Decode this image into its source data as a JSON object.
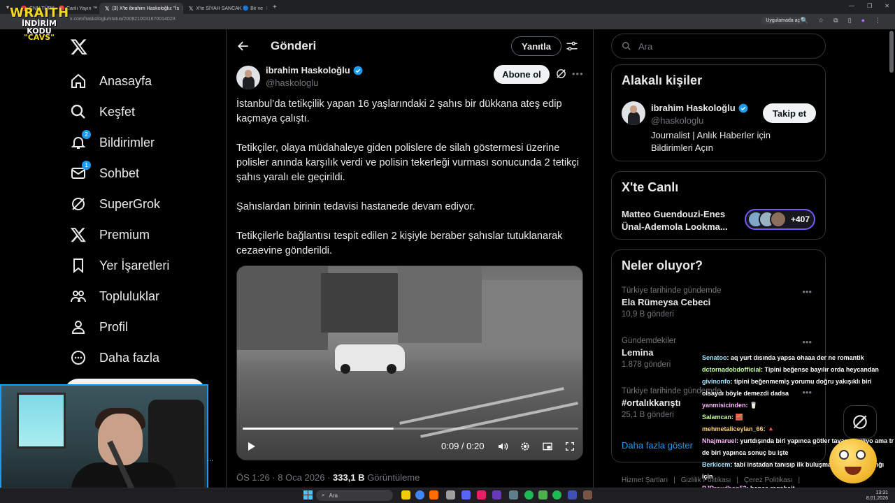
{
  "browser": {
    "tabs": [
      {
        "title": "CNN TÜRK - 🔴 Canlı Yayın ™",
        "color": "#ff0000",
        "active": false
      },
      {
        "title": "(3) X'te ibrahim Haskoloğlu: \"İs",
        "color": "#ffffff",
        "active": true
      },
      {
        "title": "X'te SİYAH SANCAK 🔵 Bir ve",
        "color": "#ffffff",
        "active": false
      }
    ],
    "url": "x.com/haskologlu/status/2009210031670014023",
    "app_chip": "Uygulamada aç"
  },
  "overlay": {
    "brand_top": "WRAITH",
    "brand_mid": "İNDİRİM KODU",
    "brand_bot": "\"CAVS\""
  },
  "nav": {
    "items": [
      {
        "label": "Anasayfa",
        "icon": "home-icon",
        "badge": ""
      },
      {
        "label": "Keşfet",
        "icon": "search-icon",
        "badge": ""
      },
      {
        "label": "Bildirimler",
        "icon": "bell-icon",
        "badge": "2"
      },
      {
        "label": "Sohbet",
        "icon": "mail-icon",
        "badge": "1"
      },
      {
        "label": "SuperGrok",
        "icon": "grok-icon",
        "badge": ""
      },
      {
        "label": "Premium",
        "icon": "x-icon",
        "badge": ""
      },
      {
        "label": "Yer İşaretleri",
        "icon": "bookmark-icon",
        "badge": ""
      },
      {
        "label": "Topluluklar",
        "icon": "communities-icon",
        "badge": ""
      },
      {
        "label": "Profil",
        "icon": "profile-icon",
        "badge": ""
      },
      {
        "label": "Daha fazla",
        "icon": "more-circle-icon",
        "badge": ""
      }
    ]
  },
  "post": {
    "header_title": "Gönderi",
    "reply_button": "Yanıtla",
    "author_name": "ibrahim Haskoloğlu",
    "author_handle": "@haskologlu",
    "subscribe_button": "Abone ol",
    "paragraphs": [
      "İstanbul’da tetikçilik yapan 16 yaşlarındaki 2 şahıs bir dükkana ateş edip kaçmaya çalıştı.",
      "Tetikçiler, olaya müdahaleye giden polislere de silah göstermesi üzerine polisler anında karşılık verdi ve polisin tekerleği vurması sonucunda 2 tetikçi şahıs yaralı ele geçirildi.",
      "Şahıslardan birinin tedavisi hastanede devam ediyor.",
      "Tetikçilerle bağlantısı tespit edilen 2 kişiyle beraber şahıslar tutuklanarak cezaevine gönderildi."
    ],
    "video": {
      "time": "0:09 / 0:20",
      "progress": 0.45
    },
    "meta_time": "ÖS 1:26 · 8 Oca 2026 · ",
    "meta_views": "333,1 B",
    "meta_views_label": " Görüntüleme"
  },
  "right": {
    "search_placeholder": "Ara",
    "related": {
      "title": "Alakalı kişiler",
      "name": "ibrahim Haskoloğlu",
      "handle": "@haskologlu",
      "bio": "Journalist | Anlık Haberler için Bildirimleri Açın",
      "follow_button": "Takip et"
    },
    "live": {
      "title": "X'te Canlı",
      "event": "Matteo Guendouzi-Enes Ünal-Ademola Lookma...",
      "count": "+407"
    },
    "trends": {
      "title": "Neler oluyor?",
      "items": [
        {
          "category": "Türkiye tarihinde gündemde",
          "name": "Ela Rümeysa Cebeci",
          "count": "10,9 B gönderi"
        },
        {
          "category": "Gündemdekiler",
          "name": "Lemina",
          "count": "1.878 gönderi"
        },
        {
          "category": "Türkiye tarihinde gündemde",
          "name": "#ortalıkkarıştı",
          "count": "25,1 B gönderi"
        }
      ],
      "show_more": "Daha fazla göster"
    },
    "footer": [
      "Hizmet Şartları",
      "|",
      "Gizlilik Politikası",
      "|",
      "Çerez Politikası",
      "|"
    ]
  },
  "chat": [
    {
      "user": "Senatoo",
      "msg": ": aq yurt dısında yapsa ohaaa der ne romantik",
      "cls": "u1"
    },
    {
      "user": "dctornadobdofficial",
      "msg": ": Tipini beğense bayılır orda heycandan",
      "cls": "u2"
    },
    {
      "user": "givinonfo",
      "msg": ": tipini beğenmemiş yorumu doğru yakışıklı biri olsaydı böyle demezdi dadsa",
      "cls": "u1"
    },
    {
      "user": "yanmisicinden",
      "msg": ": 🥛",
      "cls": "u3"
    },
    {
      "user": "Salamcan",
      "msg": ": 🧱",
      "cls": "u2"
    },
    {
      "user": "mehmetaliceylan_66",
      "msg": ": 🔺",
      "cls": "u4"
    },
    {
      "user": "Nhajmaruel",
      "msg": ": yurtdışında biri yapınca götler tavan geziliyo ama tr de biri yapınca sonuç bu işte",
      "cls": "u3"
    },
    {
      "user": "Berkicem",
      "msg": ": tabi instadan tanısıp ilk buluşmada 20k sokmadığı için",
      "cls": "u1"
    },
    {
      "user": "PJProudhon53",
      "msg": ": bence ragebait",
      "cls": "u3"
    }
  ],
  "taskbar": {
    "search": "Ara",
    "clock_time": "13:31",
    "clock_date": "8.01.2026"
  },
  "colors": {
    "accent": "#1d9bf0",
    "background": "#000000",
    "border": "#2f3336",
    "muted": "#71767b",
    "live_border": "#7856ff"
  }
}
